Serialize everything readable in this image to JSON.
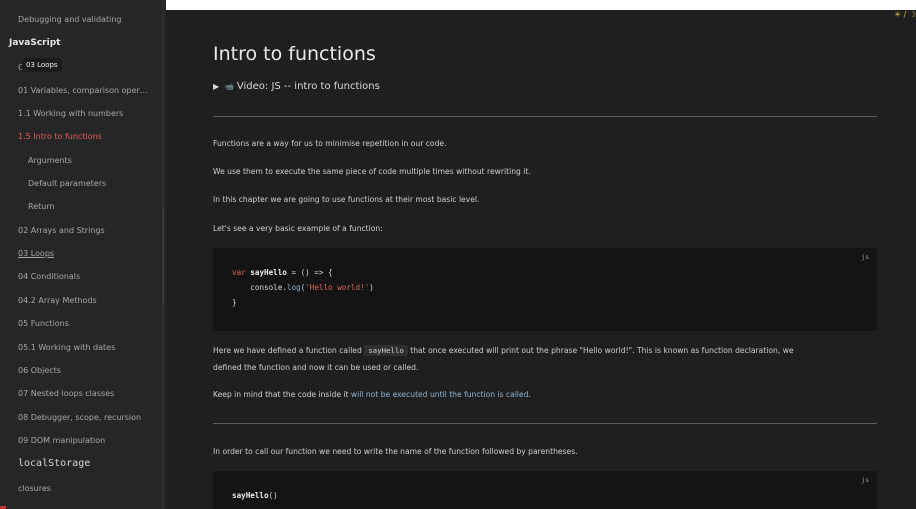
{
  "sidebar": {
    "top_item": "Debugging and validating",
    "section_heading": "JavaScript",
    "tooltip": "03 Loops",
    "tooltip_hidden_prefix": "C",
    "items": [
      {
        "label": "01 Variables, comparison oper…"
      },
      {
        "label": "1.1 Working with numbers"
      },
      {
        "label": "1.5 Intro to functions",
        "active": true
      },
      {
        "label": "Arguments",
        "sub": true
      },
      {
        "label": "Default parameters",
        "sub": true
      },
      {
        "label": "Return",
        "sub": true
      },
      {
        "label": "02 Arrays and Strings"
      },
      {
        "label": "03 Loops"
      },
      {
        "label": "04 Conditionals"
      },
      {
        "label": "04.2 Array Methods"
      },
      {
        "label": "05 Functions"
      },
      {
        "label": "05.1 Working with dates"
      },
      {
        "label": "06 Objects"
      },
      {
        "label": "07 Nested loops classes"
      },
      {
        "label": "08 Debugger, scope, recursion"
      },
      {
        "label": "09 DOM manipulation"
      }
    ],
    "mono_item": "localStorage",
    "last_item": "closures"
  },
  "header": {
    "theme_toggle": "☀ / ☽",
    "accent": "#e0b84a"
  },
  "main": {
    "title": "Intro to functions",
    "video_label": "Video: JS -- intro to functions",
    "paragraphs": {
      "p1": "Functions are a way for us to minimise repetition in our code.",
      "p2": "We use them to execute the same piece of code multiple times without rewriting it.",
      "p3": "In this chapter we are going to use functions at their most basic level.",
      "p4": "Let's see a very basic example of a function:",
      "p5_before": "Here we have defined a function called ",
      "p5_code": "sayHello",
      "p5_after": " that once executed will print out the phrase \"Hello world!\". This is known as function declaration, we",
      "p5_line2": "defined the function and now it can be used or called.",
      "p6_before": "Keep in mind that the code inside it ",
      "p6_highlight": "will not be executed until the function is called",
      "p6_after": ".",
      "p7": "In order to call our function we need to write the name of the function followed by parentheses."
    },
    "code1": {
      "lang": "js",
      "kw": "var",
      "fn": "sayHello",
      "rest1": " = () => {",
      "obj": "console",
      "dot": ".",
      "meth": "log",
      "paren_open": "(",
      "str": "'Hello world!'",
      "paren_close": ")",
      "close": "}"
    },
    "code2": {
      "lang": "js",
      "fn": "sayHello",
      "call": "()"
    }
  },
  "colors": {
    "background": "#1f1f20",
    "sidebar": "#262627",
    "active_link": "#e65e56",
    "code_bg": "#141415"
  }
}
